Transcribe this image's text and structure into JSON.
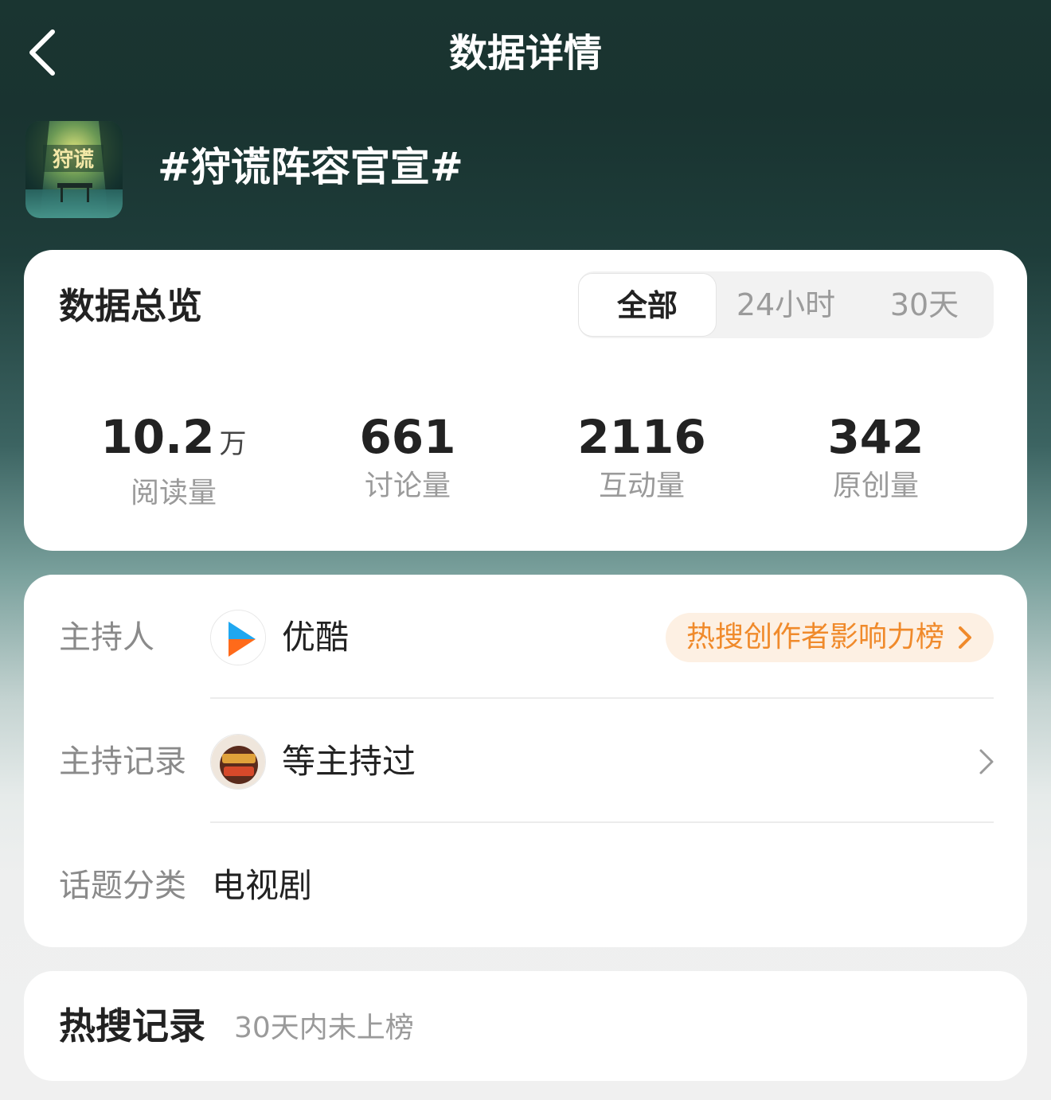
{
  "nav": {
    "title": "数据详情",
    "back_icon": "chevron-left-icon"
  },
  "topic": {
    "title": "#狩谎阵容官宣#",
    "cover_text": "狩谎"
  },
  "overview": {
    "title": "数据总览",
    "tabs": [
      {
        "label": "全部",
        "active": true
      },
      {
        "label": "24小时",
        "active": false
      },
      {
        "label": "30天",
        "active": false
      }
    ],
    "stats": [
      {
        "value": "10.2",
        "unit": "万",
        "label": "阅读量"
      },
      {
        "value": "661",
        "unit": "",
        "label": "讨论量"
      },
      {
        "value": "2116",
        "unit": "",
        "label": "互动量"
      },
      {
        "value": "342",
        "unit": "",
        "label": "原创量"
      }
    ]
  },
  "info": {
    "host_label": "主持人",
    "host_name": "优酷",
    "rank_badge": "热搜创作者影响力榜",
    "record_label": "主持记录",
    "record_value": "等主持过",
    "category_label": "话题分类",
    "category_value": "电视剧"
  },
  "hot": {
    "title": "热搜记录",
    "subtitle": "30天内未上榜"
  },
  "colors": {
    "accent_orange": "#f08a2b",
    "pill_bg": "#fdf0e3",
    "youku_blue": "#1fa7f0",
    "youku_orange": "#ff6a1a"
  }
}
